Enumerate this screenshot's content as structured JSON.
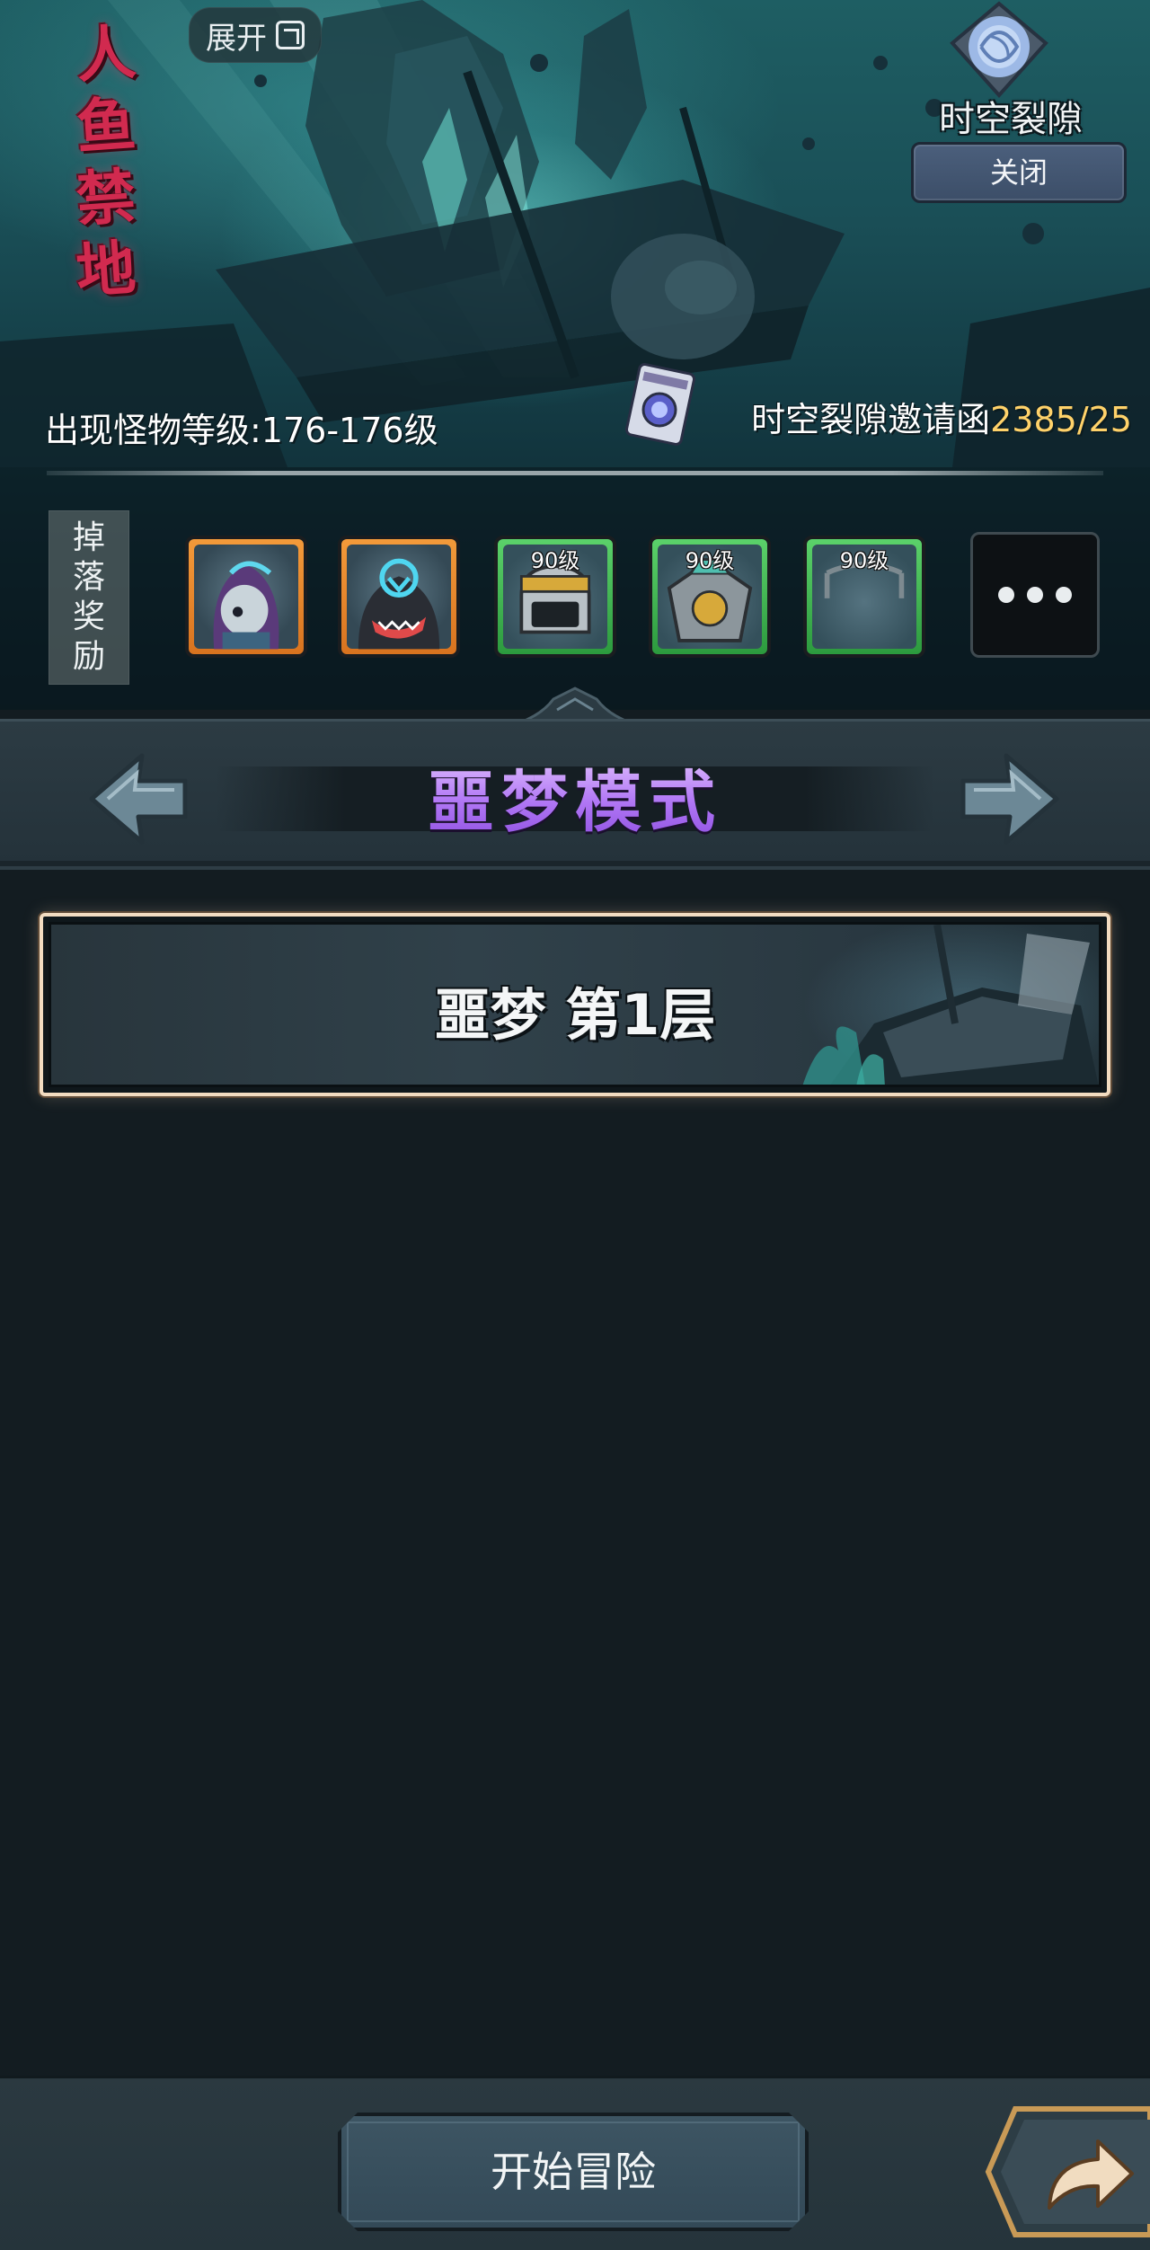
{
  "hero": {
    "logo_chars": [
      "人",
      "鱼",
      "禁",
      "地"
    ],
    "expand_label": "展开",
    "rift_label": "时空裂隙",
    "close_label": "关闭",
    "monster_level": "出现怪物等级:176-176级",
    "invite_label": "时空裂隙邀请函",
    "invite_count": "2385/25"
  },
  "drops": {
    "label_chars": [
      "掉",
      "落",
      "奖",
      "励"
    ],
    "items": [
      {
        "rarity": "orange",
        "level": "",
        "icon": "hooded-hero-portrait"
      },
      {
        "rarity": "orange",
        "level": "",
        "icon": "shark-hero-portrait"
      },
      {
        "rarity": "green",
        "level": "90级",
        "icon": "helmet-equipment"
      },
      {
        "rarity": "green",
        "level": "90级",
        "icon": "armor-equipment"
      },
      {
        "rarity": "green",
        "level": "90级",
        "icon": "necklace-equipment"
      }
    ],
    "more_icon": "more-dots-icon"
  },
  "mode": {
    "title": "噩梦模式",
    "prev_icon": "arrow-left-icon",
    "next_icon": "arrow-right-icon"
  },
  "floors": [
    {
      "label": "噩梦 第1层"
    }
  ],
  "footer": {
    "start_label": "开始冒险",
    "share_icon": "share-arrow-icon"
  },
  "colors": {
    "accent_purple": "#b177f5",
    "invite_count": "#ffd26a",
    "floor_border": "#f2dcc1",
    "logo_red": "#d12a4f"
  }
}
